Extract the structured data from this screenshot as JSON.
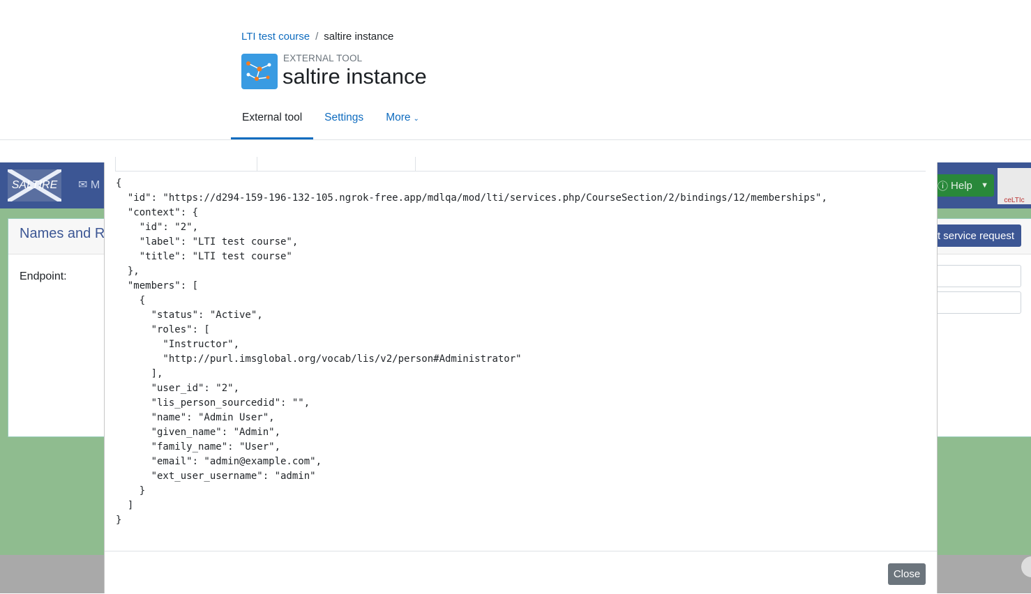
{
  "breadcrumb": {
    "course": "LTI test course",
    "separator": "/",
    "current": "saltire instance"
  },
  "activity": {
    "type": "EXTERNAL TOOL",
    "title": "saltire instance",
    "icon": "lti-network-icon"
  },
  "tabs": [
    {
      "label": "External tool",
      "active": true
    },
    {
      "label": "Settings",
      "active": false
    },
    {
      "label": "More",
      "active": false
    }
  ],
  "backdrop": {
    "logo": "SALTIRE",
    "nav_item": "M",
    "help": "Help",
    "celtic": "ceLTIc",
    "card_title": "Names and R",
    "endpoint_label": "Endpoint:",
    "request_button": "st service request"
  },
  "modal": {
    "json_text": "{\n  \"id\": \"https://d294-159-196-132-105.ngrok-free.app/mdlqa/mod/lti/services.php/CourseSection/2/bindings/12/memberships\",\n  \"context\": {\n    \"id\": \"2\",\n    \"label\": \"LTI test course\",\n    \"title\": \"LTI test course\"\n  },\n  \"members\": [\n    {\n      \"status\": \"Active\",\n      \"roles\": [\n        \"Instructor\",\n        \"http://purl.imsglobal.org/vocab/lis/v2/person#Administrator\"\n      ],\n      \"user_id\": \"2\",\n      \"lis_person_sourcedid\": \"\",\n      \"name\": \"Admin User\",\n      \"given_name\": \"Admin\",\n      \"family_name\": \"User\",\n      \"email\": \"admin@example.com\",\n      \"ext_user_username\": \"admin\"\n    }\n  ]\n}",
    "close_label": "Close"
  },
  "colors": {
    "moodle_link": "#0f6cbf",
    "saltire_nav": "#3c5694",
    "backdrop_green": "#8fbc8f",
    "help_green": "#29883a",
    "close_gray": "#6c757d"
  }
}
